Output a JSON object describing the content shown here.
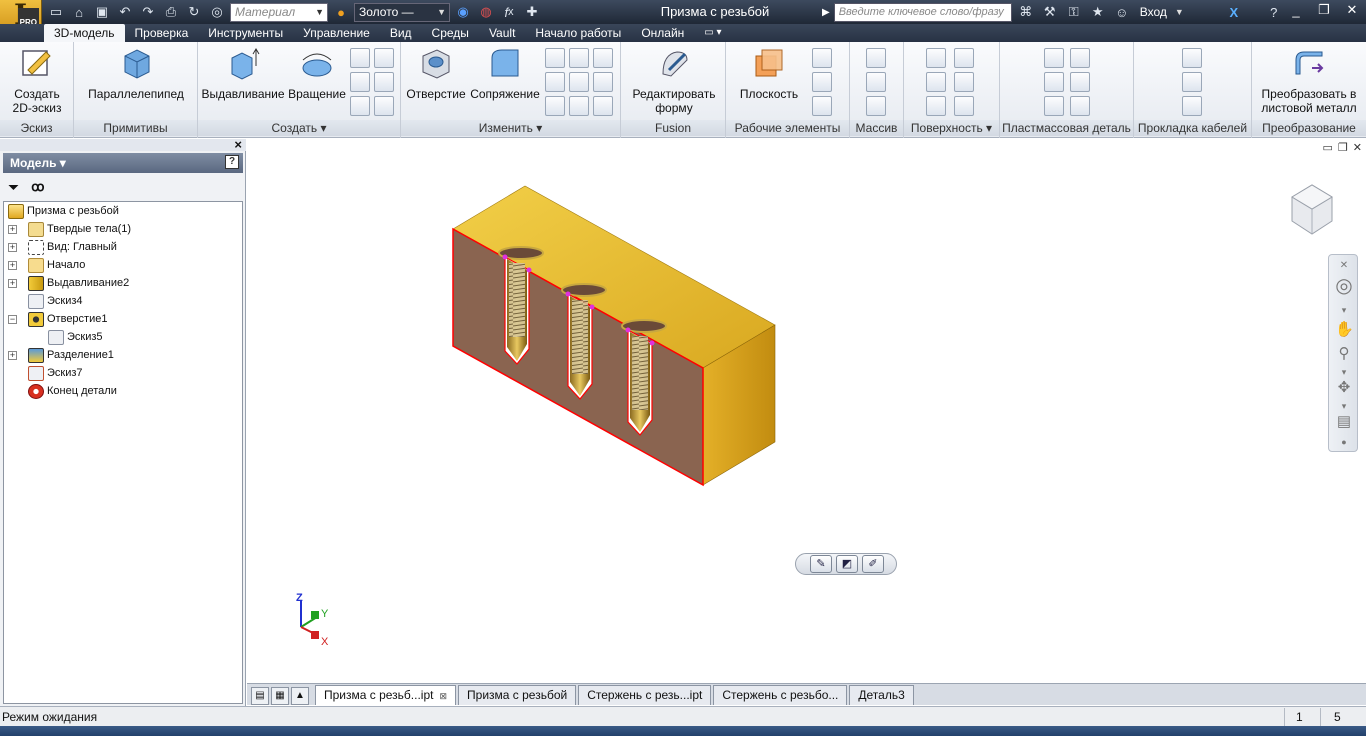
{
  "app": {
    "logo_letter": "I",
    "edition": "PRO",
    "window_title": "Призма с резьбой",
    "search_placeholder": "Введите ключевое слово/фразу",
    "sign_in": "Вход",
    "material_placeholder": "Материал",
    "appearance_value": "Золото —"
  },
  "tabs": [
    "3D-модель",
    "Проверка",
    "Инструменты",
    "Управление",
    "Вид",
    "Среды",
    "Vault",
    "Начало работы",
    "Онлайн"
  ],
  "ribbon": {
    "groups": {
      "sketch": "Эскиз",
      "primitives": "Примитивы",
      "create": "Создать",
      "modify": "Изменить",
      "fusion": "Fusion",
      "work": "Рабочие элементы",
      "pattern": "Массив",
      "surface": "Поверхность",
      "plastic": "Пластмассовая деталь",
      "cable": "Прокладка кабелей",
      "convert": "Преобразование"
    },
    "buttons": {
      "create_sketch_1": "Создать",
      "create_sketch_2": "2D-эскиз",
      "box": "Параллелепипед",
      "extrude": "Выдавливание",
      "revolve": "Вращение",
      "hole": "Отверстие",
      "fillet": "Сопряжение",
      "edit_form_1": "Редактировать",
      "edit_form_2": "форму",
      "plane": "Плоскость",
      "sheet_metal_1": "Преобразовать в",
      "sheet_metal_2": "листовой металл"
    }
  },
  "browser": {
    "header": "Модель",
    "items": [
      {
        "label": "Призма с резьбой",
        "icon": "part-icon"
      },
      {
        "label": "Твердые тела(1)",
        "icon": "folder-bodies-icon"
      },
      {
        "label": "Вид: Главный",
        "icon": "view-icon"
      },
      {
        "label": "Начало",
        "icon": "folder-origin-icon"
      },
      {
        "label": "Выдавливание2",
        "icon": "extrude-icon"
      },
      {
        "label": "Эскиз4",
        "icon": "sketch-icon"
      },
      {
        "label": "Отверстие1",
        "icon": "hole-icon"
      },
      {
        "label": "Эскиз5",
        "icon": "sketch-icon"
      },
      {
        "label": "Разделение1",
        "icon": "split-icon"
      },
      {
        "label": "Эскиз7",
        "icon": "sketch-icon"
      },
      {
        "label": "Конец детали",
        "icon": "end-of-part-icon"
      }
    ]
  },
  "triad": {
    "z": "Z",
    "y": "Y",
    "x": "X"
  },
  "doc_tabs": [
    "Призма с резьб...ipt",
    "Призма с резьбой",
    "Стержень с резь...ipt",
    "Стержень с резьбо...",
    "Деталь3"
  ],
  "status": {
    "message": "Режим ожидания",
    "count1": "1",
    "count2": "5"
  },
  "colors": {
    "accent": "#2f3b4f",
    "model_gold": "#e8b830",
    "section_face": "#8a6450",
    "section_edge": "#ff0000"
  }
}
